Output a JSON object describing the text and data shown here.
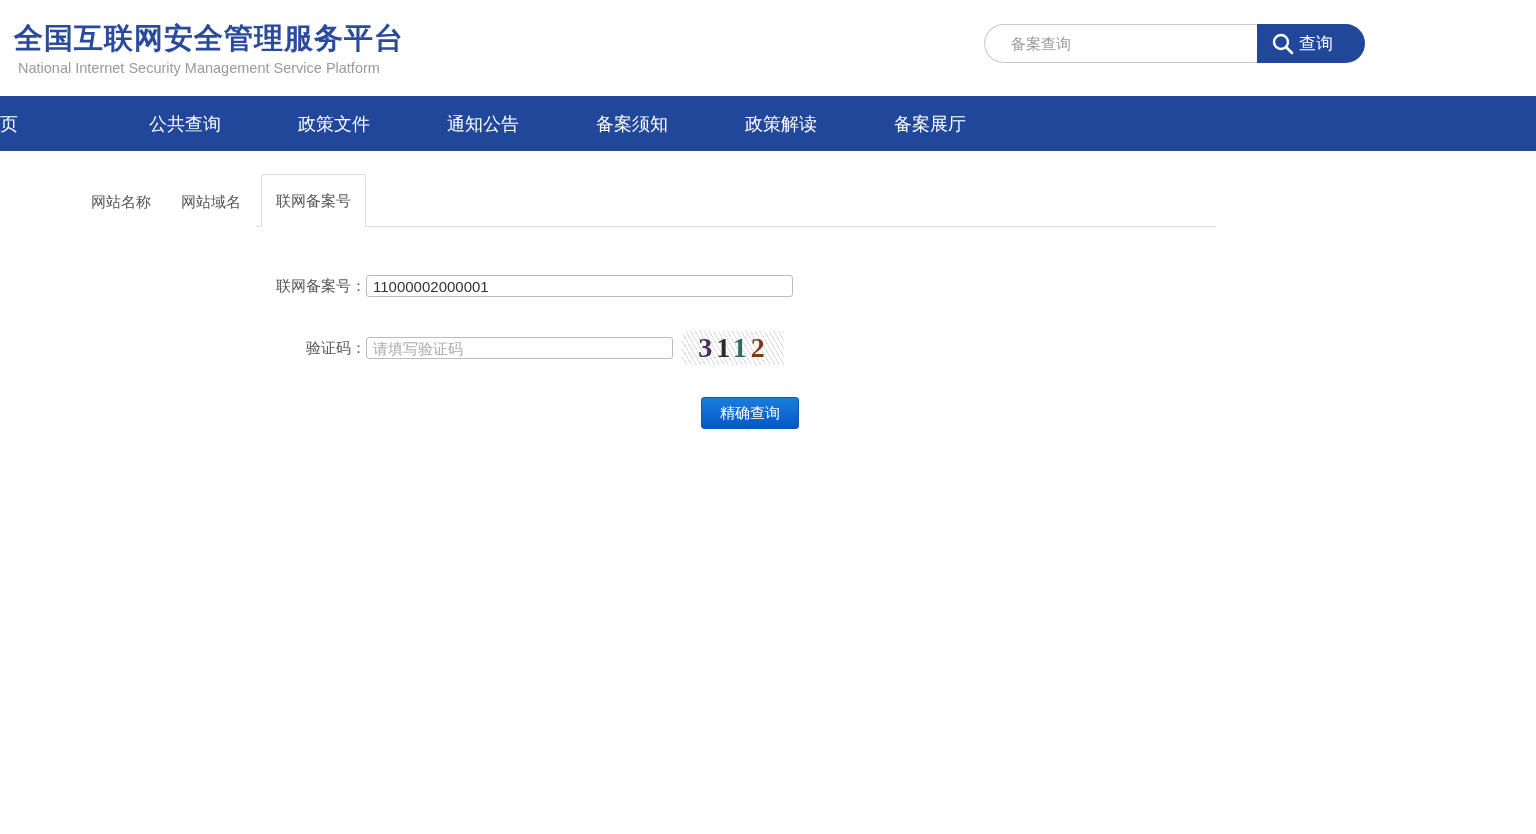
{
  "header": {
    "title": "全国互联网安全管理服务平台",
    "subtitle": "National Internet Security Management Service Platform",
    "search": {
      "placeholder": "备案查询",
      "button": "查询"
    }
  },
  "nav": {
    "items": [
      {
        "label": "页"
      },
      {
        "label": "公共查询"
      },
      {
        "label": "政策文件"
      },
      {
        "label": "通知公告"
      },
      {
        "label": "备案须知"
      },
      {
        "label": "政策解读"
      },
      {
        "label": "备案展厅"
      }
    ]
  },
  "tabs": [
    {
      "label": "网站名称",
      "selected": false
    },
    {
      "label": "网站域名",
      "selected": false
    },
    {
      "label": "联网备案号",
      "selected": true
    }
  ],
  "form": {
    "fields": [
      {
        "label": "联网备案号：",
        "value": "11000002000001",
        "kind": "text"
      },
      {
        "label": "验证码：",
        "placeholder": "请填写验证码",
        "kind": "captcha",
        "captcha": "3112"
      }
    ],
    "button": "精确查询"
  }
}
